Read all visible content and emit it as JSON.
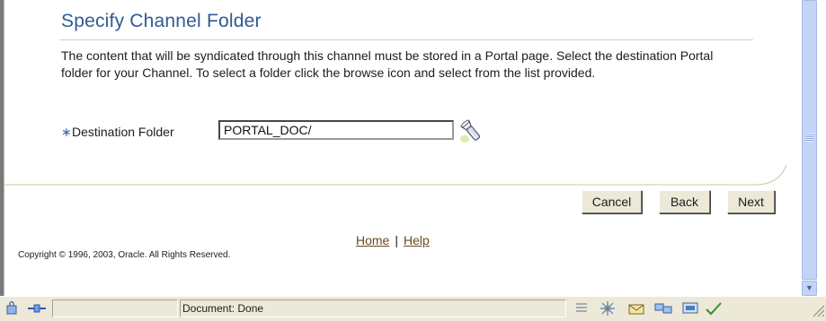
{
  "page": {
    "title": "Specify Channel Folder",
    "description": "The content that will be syndicated through this channel must be stored in a Portal page. Select the destination Portal folder for your Channel. To select a folder click the browse icon and select from the list provided.",
    "required_marker": "∗",
    "destination_label": "Destination Folder",
    "destination_value": "PORTAL_DOC/",
    "browse_icon": "flashlight-browse-icon"
  },
  "buttons": {
    "cancel": "Cancel",
    "back": "Back",
    "next": "Next"
  },
  "footer": {
    "home": "Home",
    "separator": "|",
    "help": "Help",
    "copyright": "Copyright © 1996, 2003, Oracle. All Rights Reserved."
  },
  "statusbar": {
    "text": "Document: Done"
  },
  "colors": {
    "title": "#2f5b93",
    "required": "#3b64b4",
    "link": "#6b4a1f",
    "rule": "#d7d2b2"
  }
}
